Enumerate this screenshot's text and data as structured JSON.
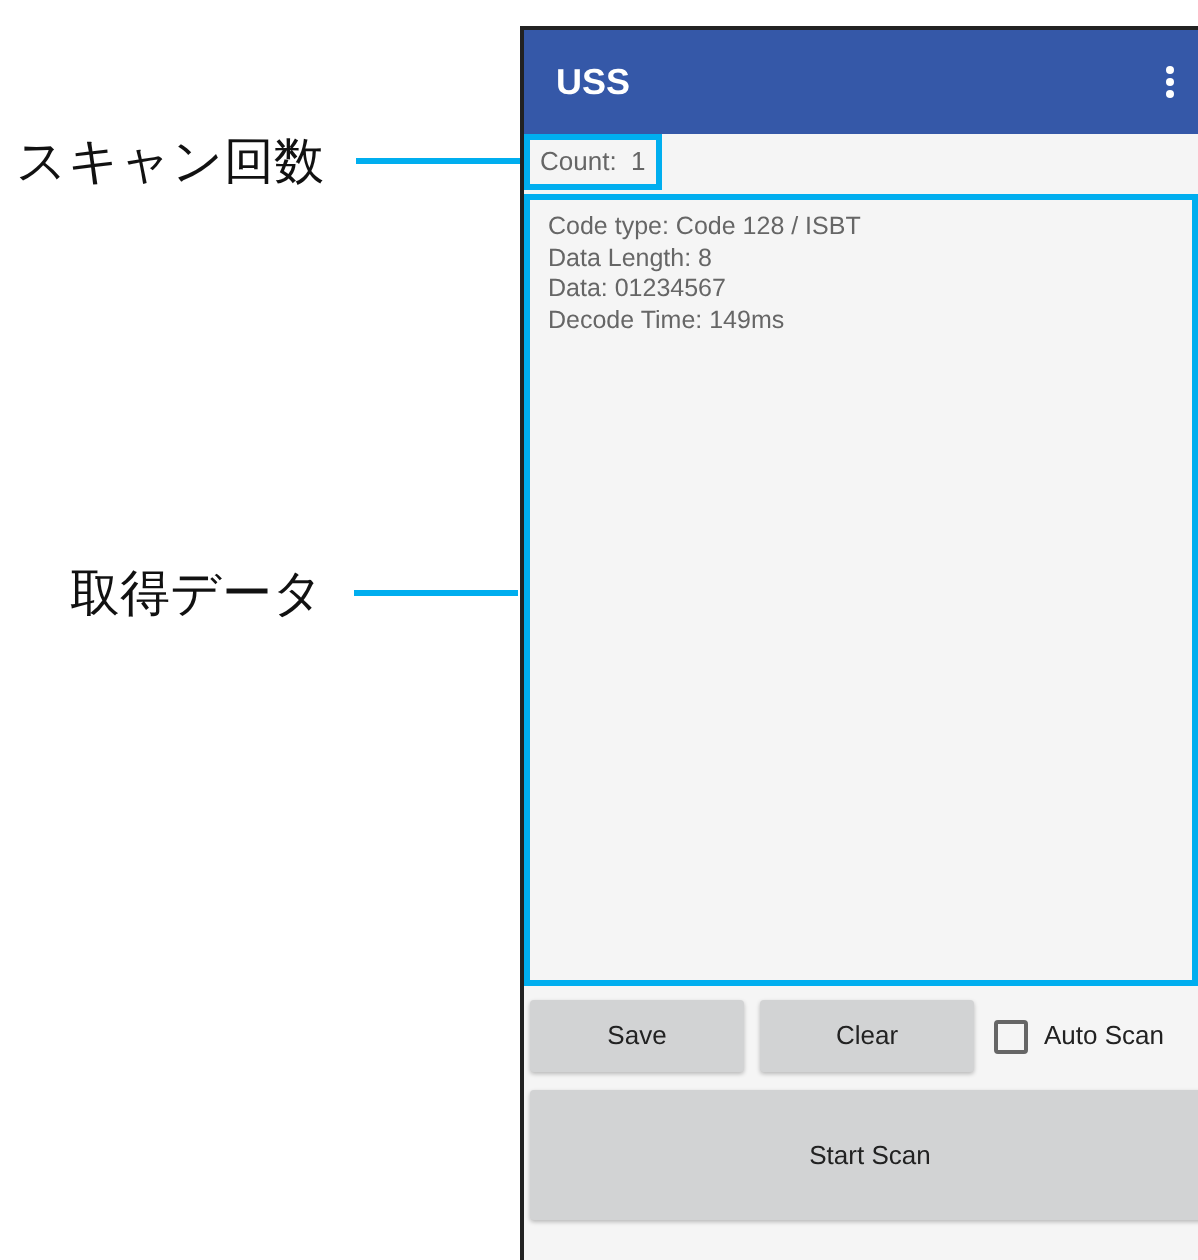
{
  "annotations": [
    {
      "label": "スキャン回数"
    },
    {
      "label": "取得データ"
    }
  ],
  "app_bar": {
    "title": "USS"
  },
  "count": {
    "label": "Count:",
    "value": "1",
    "highlighted": true
  },
  "data_highlighted": true,
  "data_lines": [
    "Code type: Code 128 / ISBT",
    "Data Length: 8",
    "Data: 01234567",
    "Decode Time: 149ms"
  ],
  "buttons": [
    {
      "label": "Save"
    },
    {
      "label": "Clear"
    }
  ],
  "auto_scan": {
    "label": "Auto Scan",
    "checked": false
  },
  "start_button": {
    "label": "Start Scan"
  }
}
